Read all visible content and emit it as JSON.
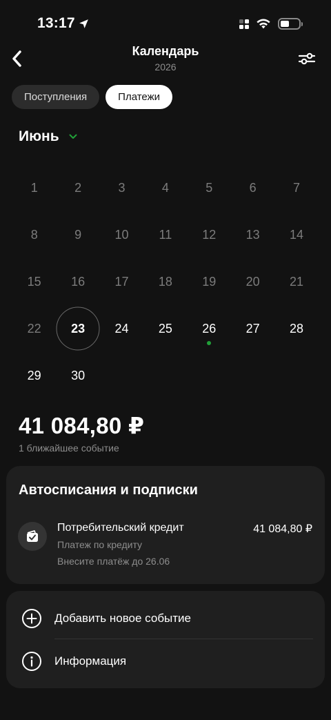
{
  "status_bar": {
    "time": "13:17"
  },
  "header": {
    "title": "Календарь",
    "year": "2026"
  },
  "tabs": [
    {
      "label": "Поступления",
      "active": false
    },
    {
      "label": "Платежи",
      "active": true
    }
  ],
  "month": {
    "label": "Июнь"
  },
  "calendar": {
    "rows": [
      [
        "1",
        "2",
        "3",
        "4",
        "5",
        "6",
        "7"
      ],
      [
        "8",
        "9",
        "10",
        "11",
        "12",
        "13",
        "14"
      ],
      [
        "15",
        "16",
        "17",
        "18",
        "19",
        "20",
        "21"
      ],
      [
        "22",
        "23",
        "24",
        "25",
        "26",
        "27",
        "28"
      ],
      [
        "29",
        "30"
      ]
    ],
    "today": "23",
    "event_days": [
      "26"
    ]
  },
  "summary": {
    "total": "41 084,80 ₽",
    "subtitle": "1 ближайшее событие"
  },
  "autopay": {
    "title": "Автосписания и подписки",
    "item": {
      "name": "Потребительский кредит",
      "amount": "41 084,80 ₽",
      "type": "Платеж по кредиту",
      "due": "Внесите платёж до 26.06"
    }
  },
  "actions": {
    "add_event": "Добавить новое событие",
    "info": "Информация"
  },
  "colors": {
    "accent": "#21a038",
    "background": "#121212",
    "card": "#1f1f1f"
  }
}
